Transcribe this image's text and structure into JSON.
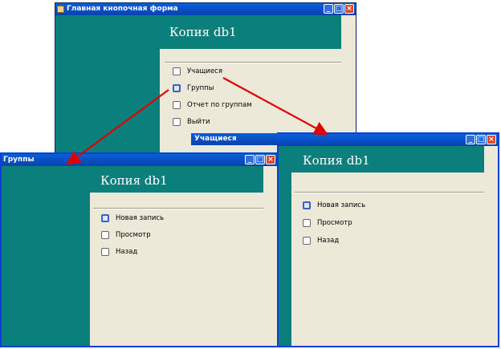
{
  "main_window": {
    "title": "Главная кнопочная форма",
    "header": "Копия db1",
    "items": [
      {
        "label": "Учащиеся"
      },
      {
        "label": "Группы"
      },
      {
        "label": "Отчет по группам"
      },
      {
        "label": "Выйти"
      }
    ]
  },
  "groups_window": {
    "title": "Группы",
    "header": "Копия db1",
    "items": [
      {
        "label": "Новая запись"
      },
      {
        "label": "Просмотр"
      },
      {
        "label": "Назад"
      }
    ]
  },
  "students_window": {
    "title": "Учащиеся",
    "header": "Копия db1",
    "items": [
      {
        "label": "Новая запись"
      },
      {
        "label": "Просмотр"
      },
      {
        "label": "Назад"
      }
    ]
  },
  "colors": {
    "teal": "#0a7f7c",
    "title_bar": "#0a5fd8",
    "arrow": "#e00000",
    "background": "#ece9d8"
  }
}
